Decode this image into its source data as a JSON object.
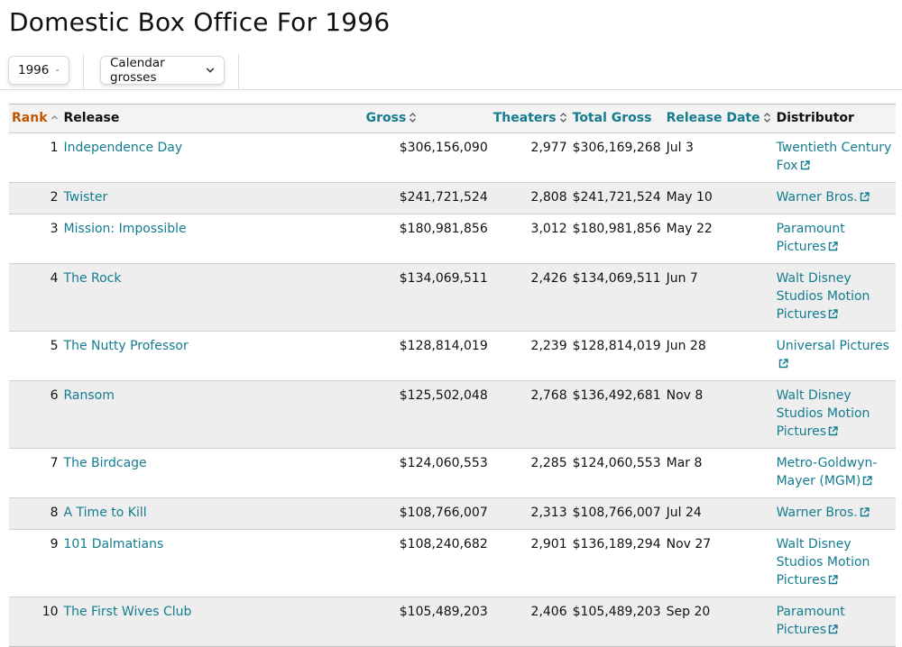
{
  "page_title": "Domestic Box Office For 1996",
  "controls": {
    "year": "1996",
    "gross_type": "Calendar grosses"
  },
  "columns": {
    "rank": "Rank",
    "release": "Release",
    "gross": "Gross",
    "theaters": "Theaters",
    "total_gross": "Total Gross",
    "release_date": "Release Date",
    "distributor": "Distributor"
  },
  "rows": [
    {
      "rank": "1",
      "release": "Independence Day",
      "gross": "$306,156,090",
      "theaters": "2,977",
      "total_gross": "$306,169,268",
      "release_date": "Jul 3",
      "distributor": "Twentieth Century Fox"
    },
    {
      "rank": "2",
      "release": "Twister",
      "gross": "$241,721,524",
      "theaters": "2,808",
      "total_gross": "$241,721,524",
      "release_date": "May 10",
      "distributor": "Warner Bros."
    },
    {
      "rank": "3",
      "release": "Mission: Impossible",
      "gross": "$180,981,856",
      "theaters": "3,012",
      "total_gross": "$180,981,856",
      "release_date": "May 22",
      "distributor": "Paramount Pictures"
    },
    {
      "rank": "4",
      "release": "The Rock",
      "gross": "$134,069,511",
      "theaters": "2,426",
      "total_gross": "$134,069,511",
      "release_date": "Jun 7",
      "distributor": "Walt Disney Studios Motion Pictures"
    },
    {
      "rank": "5",
      "release": "The Nutty Professor",
      "gross": "$128,814,019",
      "theaters": "2,239",
      "total_gross": "$128,814,019",
      "release_date": "Jun 28",
      "distributor": "Universal Pictures"
    },
    {
      "rank": "6",
      "release": "Ransom",
      "gross": "$125,502,048",
      "theaters": "2,768",
      "total_gross": "$136,492,681",
      "release_date": "Nov 8",
      "distributor": "Walt Disney Studios Motion Pictures"
    },
    {
      "rank": "7",
      "release": "The Birdcage",
      "gross": "$124,060,553",
      "theaters": "2,285",
      "total_gross": "$124,060,553",
      "release_date": "Mar 8",
      "distributor": "Metro-Goldwyn-Mayer (MGM)"
    },
    {
      "rank": "8",
      "release": "A Time to Kill",
      "gross": "$108,766,007",
      "theaters": "2,313",
      "total_gross": "$108,766,007",
      "release_date": "Jul 24",
      "distributor": "Warner Bros."
    },
    {
      "rank": "9",
      "release": "101 Dalmatians",
      "gross": "$108,240,682",
      "theaters": "2,901",
      "total_gross": "$136,189,294",
      "release_date": "Nov 27",
      "distributor": "Walt Disney Studios Motion Pictures"
    },
    {
      "rank": "10",
      "release": "The First Wives Club",
      "gross": "$105,489,203",
      "theaters": "2,406",
      "total_gross": "$105,489,203",
      "release_date": "Sep 20",
      "distributor": "Paramount Pictures"
    }
  ],
  "icons": {
    "sort": "sort-arrows-icon",
    "sort_active": "sort-up-icon",
    "external_link": "external-link-icon",
    "dropdown": "chevron-down-icon"
  },
  "colors": {
    "link": "#147c8f",
    "active_sort": "#c45500",
    "stripe": "#eeeeee",
    "header_bg": "#f3f3f3"
  }
}
